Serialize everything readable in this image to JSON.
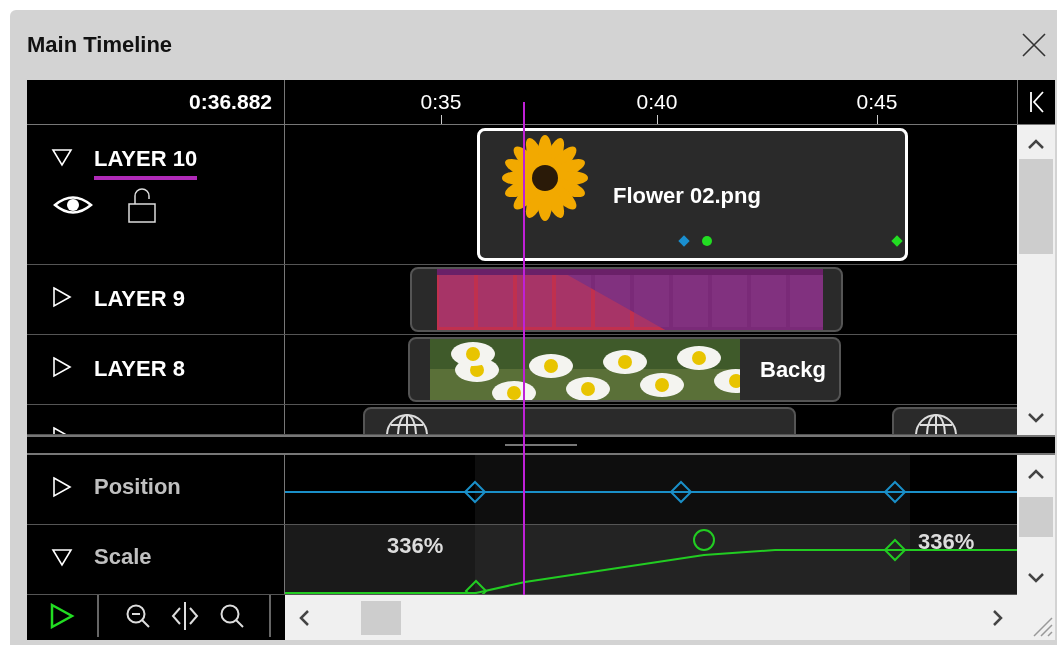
{
  "window": {
    "title": "Main Timeline"
  },
  "ruler": {
    "current_time": "0:36.882",
    "ticks": [
      "0:35",
      "0:40",
      "0:45"
    ]
  },
  "layers": [
    {
      "name": "LAYER 10",
      "expanded": true,
      "selected": true,
      "visible": true,
      "locked": false,
      "clips": [
        {
          "label": "Flower 02.png",
          "selected": true,
          "marks": [
            {
              "kind": "diamond",
              "color": "#1a8fd0"
            },
            {
              "kind": "dot",
              "color": "#22dd22"
            },
            {
              "kind": "diamond",
              "color": "#22dd22"
            }
          ]
        }
      ]
    },
    {
      "name": "LAYER 9",
      "expanded": false,
      "selected": false
    },
    {
      "name": "LAYER 8",
      "expanded": false,
      "selected": false,
      "clips": [
        {
          "kind": "video",
          "label": "Backg",
          "selected": false
        }
      ]
    },
    {
      "expanded": false,
      "selected": false,
      "clips": [
        {
          "kind": "web",
          "selected": false
        },
        {
          "kind": "web",
          "selected": false
        }
      ]
    }
  ],
  "properties": [
    {
      "name": "Position",
      "expanded": false,
      "color": "#1a8fc8",
      "keyframes": [
        {
          "kind": "diamond"
        },
        {
          "kind": "diamond"
        },
        {
          "kind": "diamond"
        }
      ]
    },
    {
      "name": "Scale",
      "expanded": true,
      "color": "#22cc22",
      "value_labels": [
        "336%",
        "336%"
      ],
      "keyframes": [
        {
          "kind": "diamond"
        },
        {
          "kind": "circle"
        },
        {
          "kind": "diamond"
        }
      ]
    }
  ]
}
